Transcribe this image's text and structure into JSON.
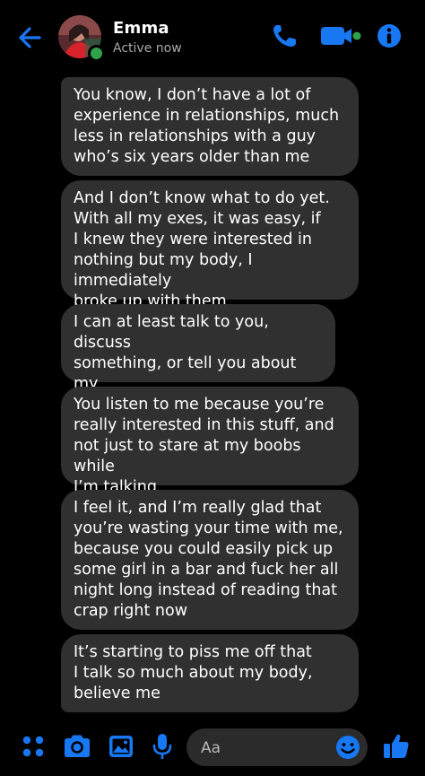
{
  "colors": {
    "accent": "#1877f2",
    "background": "#000000",
    "bubble": "#303030",
    "field": "#2b2b2b",
    "presence": "#31a24c",
    "status_text": "#a8a8a8"
  },
  "header": {
    "back_icon": "arrow-left-icon",
    "avatar_icon": "profile-photo",
    "name": "Emma",
    "status": "Active now",
    "actions": [
      "phone-icon",
      "video-camera-icon",
      "info-icon"
    ]
  },
  "messages": [
    {
      "sender": "Emma",
      "text": "You know, I don’t have a lot of\nexperience in relationships, much\nless in relationships with a guy\nwho’s six years older than me"
    },
    {
      "sender": "Emma",
      "text": "And I don’t know what to do yet.\nWith all my exes, it was easy, if\nI knew they were interested in\nnothing but my body, I immediately\nbroke up with them"
    },
    {
      "sender": "Emma",
      "text": "I can at least talk to you, discuss\nsomething, or tell you about my\nday"
    },
    {
      "sender": "Emma",
      "text": "You listen to me because you’re\nreally interested in this stuff, and\nnot just to stare at my boobs while\nI’m talking"
    },
    {
      "sender": "Emma",
      "text": "I feel it, and I’m really glad that\nyou’re wasting your time with me,\nbecause you could easily pick up\nsome girl in a bar and fuck her all\nnight long instead of reading that\ncrap right now"
    },
    {
      "sender": "Emma",
      "text": "It’s starting to piss me off that\nI talk so much about my body,\nbelieve me"
    }
  ],
  "composer": {
    "icons": [
      "apps-grid-icon",
      "camera-icon",
      "photo-icon",
      "microphone-icon",
      "emoji-icon",
      "thumbs-up-icon"
    ],
    "placeholder": "Aa"
  }
}
